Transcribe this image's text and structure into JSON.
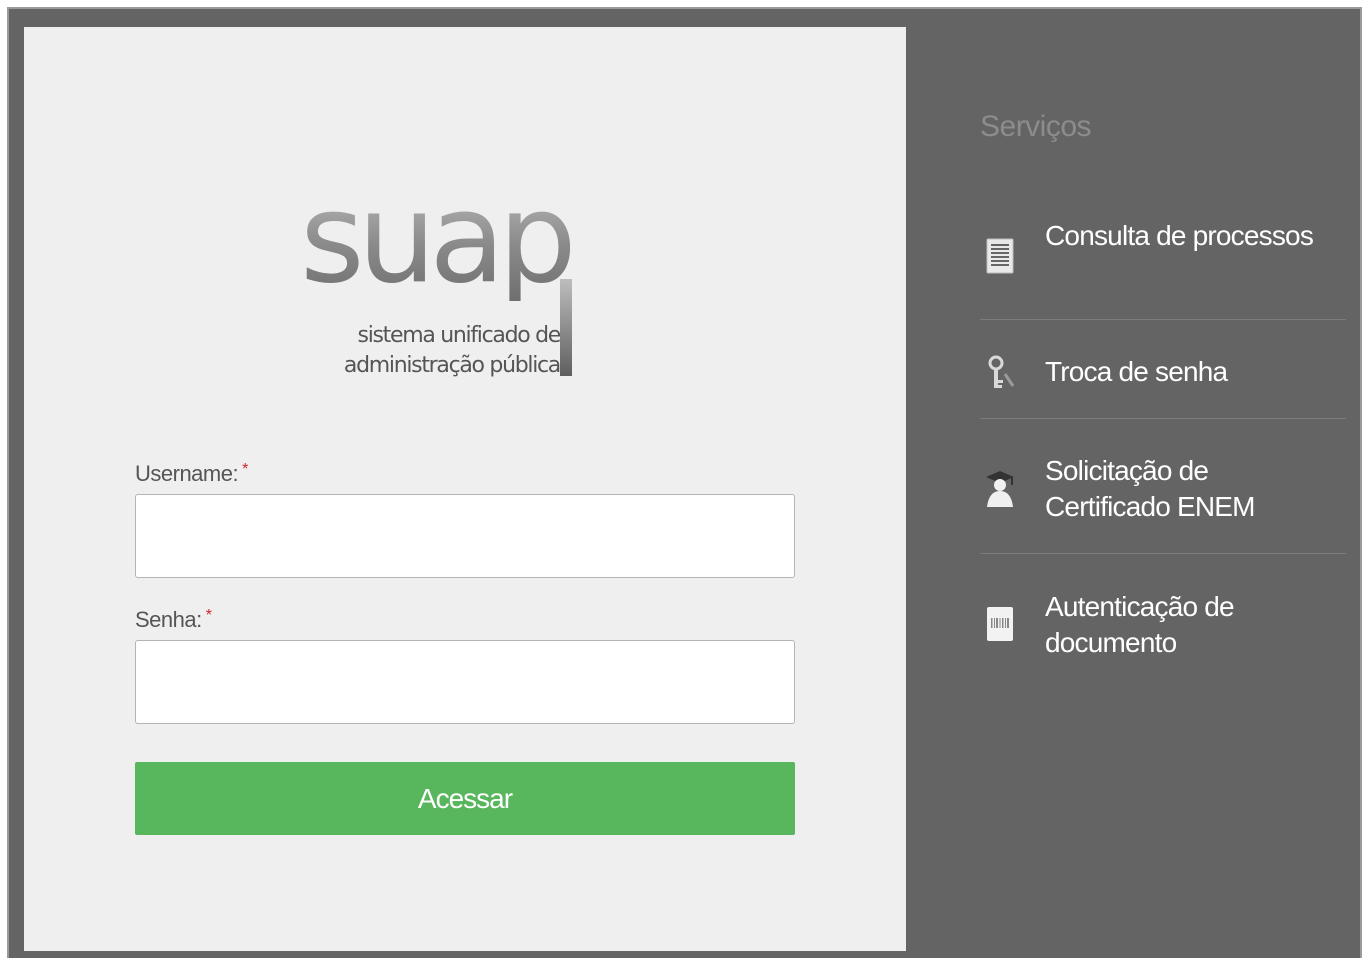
{
  "logo": {
    "word": "suap",
    "tagline_line1": "sistema unificado de",
    "tagline_line2": "administração pública"
  },
  "form": {
    "username_label": "Username:",
    "username_required": "*",
    "username_value": "",
    "password_label": "Senha:",
    "password_required": "*",
    "password_value": "",
    "submit_label": "Acessar"
  },
  "services": {
    "title": "Serviços",
    "items": [
      {
        "label": "Consulta de processos",
        "icon": "document-list-icon"
      },
      {
        "label": "Troca de senha",
        "icon": "key-icon"
      },
      {
        "label": "Solicitação de Certificado ENEM",
        "icon": "graduate-icon"
      },
      {
        "label": "Autenticação de documento",
        "icon": "barcode-document-icon"
      }
    ]
  },
  "colors": {
    "background": "#646464",
    "panel": "#efefef",
    "primary_button": "#58b65c",
    "required_marker": "#d0242b",
    "sidebar_text": "#ffffff",
    "sidebar_title": "#8c8c8c"
  }
}
